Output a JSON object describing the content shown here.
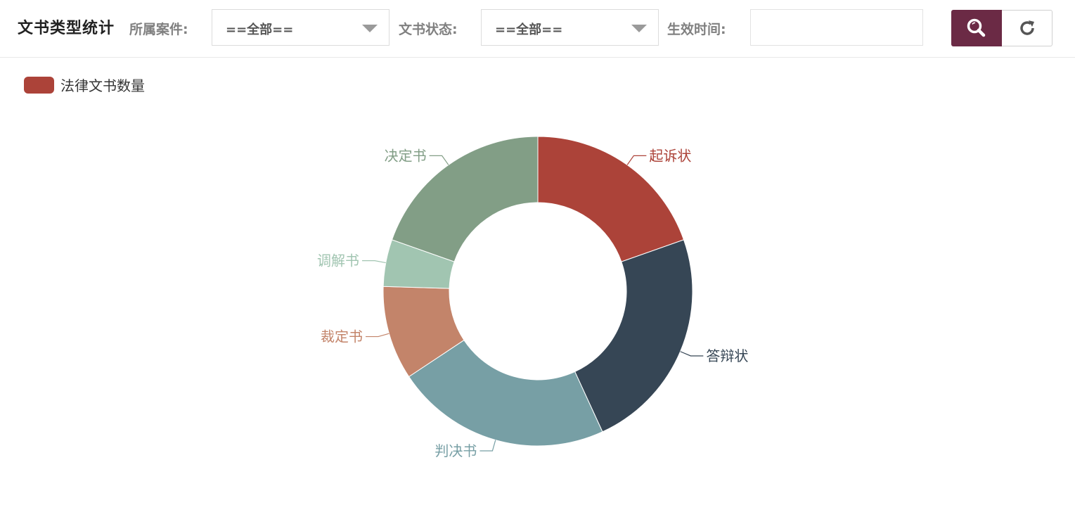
{
  "header": {
    "title": "文书类型统计",
    "case_label": "所属案件:",
    "case_value": "==全部==",
    "status_label": "文书状态:",
    "status_value": "==全部==",
    "date_label": "生效时间:",
    "date_value": ""
  },
  "icons": {
    "search": "search-icon",
    "refresh": "refresh-icon",
    "dropdown": "chevron-down-icon"
  },
  "colors": {
    "accent": "#6b2a45"
  },
  "chart_data": {
    "type": "pie",
    "variant": "donut",
    "legend": {
      "name": "法律文书数量",
      "color": "#ac4339",
      "placement": "top-left"
    },
    "slices": [
      {
        "label": "起诉状",
        "value": 20,
        "color": "#ac4339"
      },
      {
        "label": "答辩状",
        "value": 24,
        "color": "#364655"
      },
      {
        "label": "判决书",
        "value": 23,
        "color": "#779fa5"
      },
      {
        "label": "裁定书",
        "value": 10,
        "color": "#c3846a"
      },
      {
        "label": "调解书",
        "value": 5,
        "color": "#a1c5b1"
      },
      {
        "label": "决定书",
        "value": 20,
        "color": "#829e86"
      }
    ]
  }
}
